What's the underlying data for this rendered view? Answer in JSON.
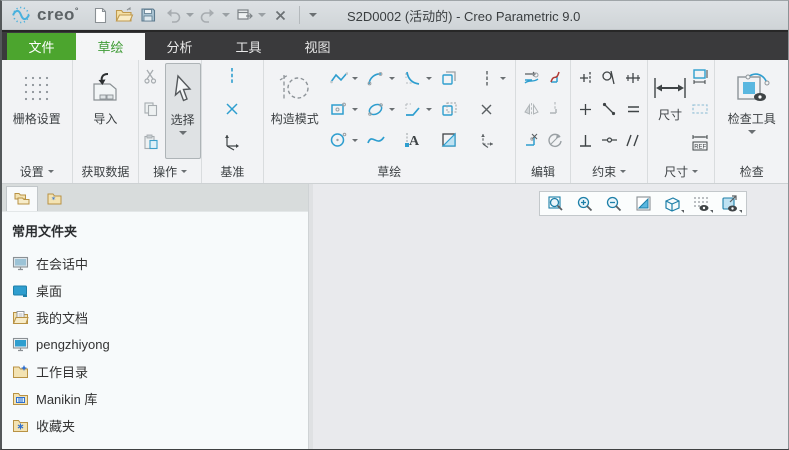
{
  "titlebar": {
    "logo": "creo",
    "logo_sup": "°",
    "title": "S2D0002 (活动的) - Creo Parametric 9.0"
  },
  "tabs": {
    "file": "文件",
    "sketch": "草绘",
    "analysis": "分析",
    "tools": "工具",
    "view": "视图"
  },
  "ribbon": {
    "settings": {
      "button": "栅格设置",
      "label": "设置"
    },
    "get_data": {
      "button": "导入",
      "label": "获取数据"
    },
    "operations": {
      "select": "选择",
      "label": "操作"
    },
    "datum": {
      "label": "基准"
    },
    "sketch": {
      "construction": "构造模式",
      "label": "草绘"
    },
    "edit": {
      "label": "编辑"
    },
    "constrain": {
      "label": "约束"
    },
    "dimension": {
      "button": "尺寸",
      "label": "尺寸",
      "ref_text": "REF"
    },
    "inspect": {
      "button": "检查工具",
      "label": "检查"
    }
  },
  "sidebar": {
    "header": "常用文件夹",
    "items": [
      {
        "label": "在会话中",
        "icon": "in-session-icon"
      },
      {
        "label": "桌面",
        "icon": "desktop-icon"
      },
      {
        "label": "我的文档",
        "icon": "my-documents-icon"
      },
      {
        "label": "pengzhiyong",
        "icon": "computer-icon"
      },
      {
        "label": "工作目录",
        "icon": "working-directory-icon"
      },
      {
        "label": "Manikin 库",
        "icon": "manikin-library-icon"
      },
      {
        "label": "收藏夹",
        "icon": "favorites-icon"
      }
    ]
  },
  "colors": {
    "accent_green": "#4ca52e",
    "icon_blue": "#2e9ecf",
    "icon_teal": "#1d7fa8",
    "graphics_bg": "#e9eaed"
  }
}
